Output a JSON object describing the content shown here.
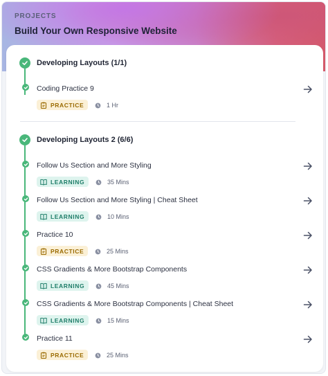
{
  "header": {
    "label": "PROJECTS",
    "title": "Build Your Own Responsive Website"
  },
  "sections": [
    {
      "title": "Developing Layouts (1/1)",
      "items": [
        {
          "title": "Coding Practice 9",
          "type": "PRACTICE",
          "duration": "1 Hr"
        }
      ]
    },
    {
      "title": "Developing Layouts 2 (6/6)",
      "items": [
        {
          "title": "Follow Us Section and More Styling",
          "type": "LEARNING",
          "duration": "35 Mins"
        },
        {
          "title": "Follow Us Section and More Styling | Cheat Sheet",
          "type": "LEARNING",
          "duration": "10 Mins"
        },
        {
          "title": "Practice 10",
          "type": "PRACTICE",
          "duration": "25 Mins"
        },
        {
          "title": "CSS Gradients & More Bootstrap Components",
          "type": "LEARNING",
          "duration": "45 Mins"
        },
        {
          "title": "CSS Gradients & More Bootstrap Components | Cheat Sheet",
          "type": "LEARNING",
          "duration": "15 Mins"
        },
        {
          "title": "Practice 11",
          "type": "PRACTICE",
          "duration": "25 Mins"
        }
      ]
    }
  ],
  "colors": {
    "complete": "#49b77a",
    "practice_bg": "#fbf0d6",
    "practice_text": "#9a6a00",
    "learning_bg": "#def4ee",
    "learning_text": "#1e7d68"
  },
  "icons": {
    "section_status": "check-circle-icon",
    "item_status": "check-dot-icon",
    "practice": "clipboard-icon",
    "learning": "book-icon",
    "duration": "clock-icon",
    "open": "arrow-right-icon"
  }
}
